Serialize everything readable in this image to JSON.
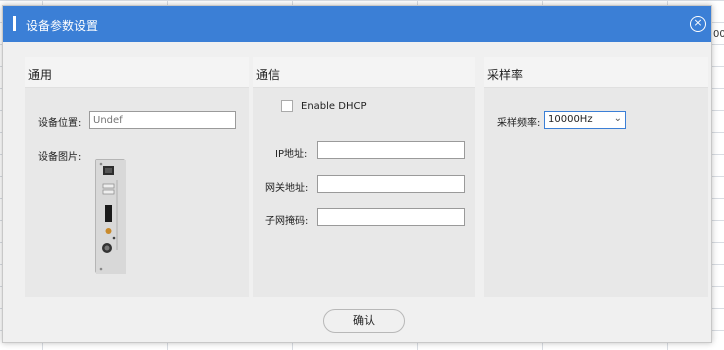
{
  "dialog": {
    "title": "设备参数设置",
    "confirm_label": "确认"
  },
  "background": {
    "fragment": "000"
  },
  "general": {
    "title": "通用",
    "location_label": "设备位置:",
    "location_placeholder": "Undef",
    "image_label": "设备图片:"
  },
  "comm": {
    "title": "通信",
    "dhcp_label": "Enable DHCP",
    "dhcp_checked": false,
    "ip_label": "IP地址:",
    "gateway_label": "网关地址:",
    "subnet_label": "子网掩码:",
    "ip_value": "",
    "gateway_value": "",
    "subnet_value": ""
  },
  "sampling": {
    "title": "采样率",
    "freq_label": "采样频率:",
    "freq_value": "10000Hz"
  },
  "colors": {
    "titlebar": "#3b7fd6",
    "panel": "#e8e8e8",
    "panel_header": "#f4f4f4"
  }
}
